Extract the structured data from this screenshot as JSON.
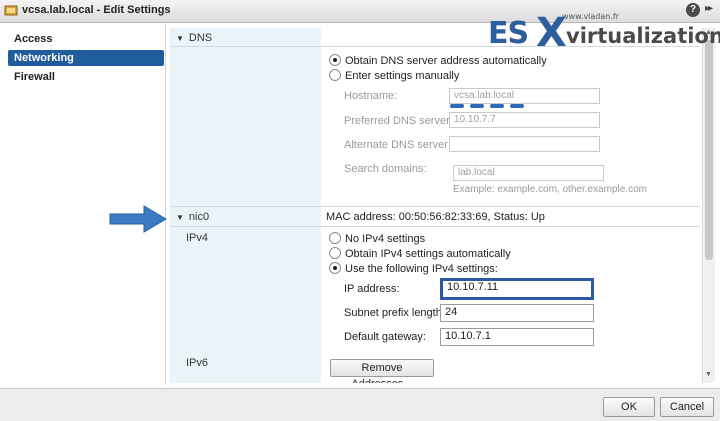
{
  "window": {
    "title": "vcsa.lab.local - Edit Settings",
    "help_label": "?",
    "expand_label": "▸▸"
  },
  "sidebar": {
    "items": [
      {
        "label": "Access",
        "active": false
      },
      {
        "label": "Networking",
        "active": true
      },
      {
        "label": "Firewall",
        "active": false
      }
    ]
  },
  "dns": {
    "section_label": "DNS",
    "radio_auto": "Obtain DNS server address automatically",
    "radio_manual": "Enter settings manually",
    "selected": "auto",
    "hostname_label": "Hostname:",
    "hostname_value": "vcsa.lab.local",
    "preferred_label": "Preferred DNS server:",
    "preferred_value": "10.10.7.7",
    "alternate_label": "Alternate DNS server:",
    "alternate_value": "",
    "search_label": "Search domains:",
    "search_value": "lab.local",
    "search_hint": "Example: example.com, other.example.com"
  },
  "nic": {
    "section_label": "nic0",
    "mac_status": "MAC address: 00:50:56:82:33:69, Status: Up",
    "ipv4_label": "IPv4",
    "radio_none": "No IPv4 settings",
    "radio_auto": "Obtain IPv4 settings automatically",
    "radio_static": "Use the following IPv4 settings:",
    "selected": "static",
    "ip_label": "IP address:",
    "ip_value": "10.10.7.11",
    "prefix_label": "Subnet prefix length:",
    "prefix_value": "24",
    "gateway_label": "Default gateway:",
    "gateway_value": "10.10.7.1",
    "ipv6_label": "IPv6",
    "remove_button": "Remove Addresses..."
  },
  "footer": {
    "ok_label": "OK",
    "cancel_label": "Cancel"
  },
  "watermark": {
    "es": "ES",
    "x": "X",
    "virt": "virtualization",
    "site": "www.vladan.fr"
  },
  "colors": {
    "accent": "#1f5d9c",
    "highlight_border": "#2a5aa5",
    "label_column": "#e9f3f8",
    "arrow": "#3b7bc4"
  }
}
